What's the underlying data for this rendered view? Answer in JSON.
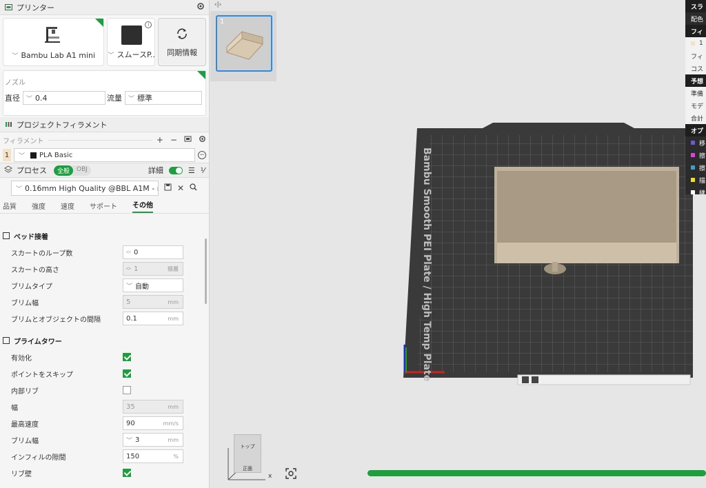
{
  "printer_section": {
    "title": "プリンター",
    "printer_name": "Bambu Lab A1 mini",
    "plate_name": "スムースP...",
    "sync_label": "同期情報"
  },
  "nozzle": {
    "title": "ノズル",
    "diameter_label": "直径",
    "diameter_value": "0.4",
    "flow_label": "流量",
    "flow_value": "標準"
  },
  "filament_section": {
    "title": "プロジェクトフィラメント",
    "sub_label": "フィラメント",
    "items": [
      {
        "index": "1",
        "name": "PLA Basic",
        "color": "#f4e2c6"
      }
    ]
  },
  "process": {
    "title": "プロセス",
    "mode_on": "全般",
    "mode_off": "OBJ",
    "detail_label": "詳細",
    "preset": "0.16mm High Quality @BBL A1M - rd...",
    "tabs": [
      "品質",
      "強度",
      "速度",
      "サポート",
      "その他"
    ],
    "active_tab": "その他"
  },
  "bed_adhesion": {
    "title": "ベッド接着",
    "skirt_loops_label": "スカートのループ数",
    "skirt_loops_value": "0",
    "skirt_height_label": "スカートの高さ",
    "skirt_height_value": "1",
    "skirt_height_unit": "積層",
    "brim_type_label": "ブリムタイプ",
    "brim_type_value": "自動",
    "brim_width_label": "ブリム幅",
    "brim_width_value": "5",
    "brim_gap_label": "ブリムとオブジェクトの間隔",
    "brim_gap_value": "0.1",
    "unit_mm": "mm"
  },
  "prime_tower": {
    "title": "プライムタワー",
    "enable_label": "有効化",
    "skip_points_label": "ポイントをスキップ",
    "internal_rib_label": "内部リブ",
    "width_label": "幅",
    "width_value": "35",
    "max_speed_label": "最高速度",
    "max_speed_value": "90",
    "max_speed_unit": "mm/s",
    "brim_width_label": "ブリム幅",
    "brim_width_value": "3",
    "infill_gap_label": "インフィルの隙間",
    "infill_gap_value": "150",
    "infill_gap_unit": "%",
    "rib_wall_label": "リブ壁",
    "unit_mm": "mm"
  },
  "viewport": {
    "thumb_index": "1",
    "plate_label": "Bambu Smooth PEI Plate / High Temp Plate",
    "view_top": "トップ",
    "view_front": "正面",
    "axis_x": "x"
  },
  "right_panel": {
    "rows": [
      {
        "text": "スラ",
        "style": "hd"
      },
      {
        "text": "配色",
        "style": ""
      },
      {
        "text": "フィ",
        "style": "hd"
      },
      {
        "text": "1",
        "style": "light"
      },
      {
        "text": "フィ",
        "style": "light"
      },
      {
        "text": "コス",
        "style": "light"
      },
      {
        "text": "予想",
        "style": "hd"
      },
      {
        "text": "準備",
        "style": "light"
      },
      {
        "text": "モデ",
        "style": "light"
      },
      {
        "text": "合計",
        "style": "light"
      },
      {
        "text": "オプ",
        "style": "hd"
      },
      {
        "text": "移",
        "style": ""
      },
      {
        "text": "擦",
        "style": ""
      },
      {
        "text": "擦",
        "style": ""
      },
      {
        "text": "描",
        "style": ""
      },
      {
        "text": "継",
        "style": ""
      }
    ],
    "swatches": [
      "#6a5acd",
      "#e040e0",
      "#40a0c0",
      "#f0e020",
      "#ffffff"
    ]
  },
  "colors": {
    "accent": "#1e9e3e",
    "selection": "#2a8be0"
  }
}
